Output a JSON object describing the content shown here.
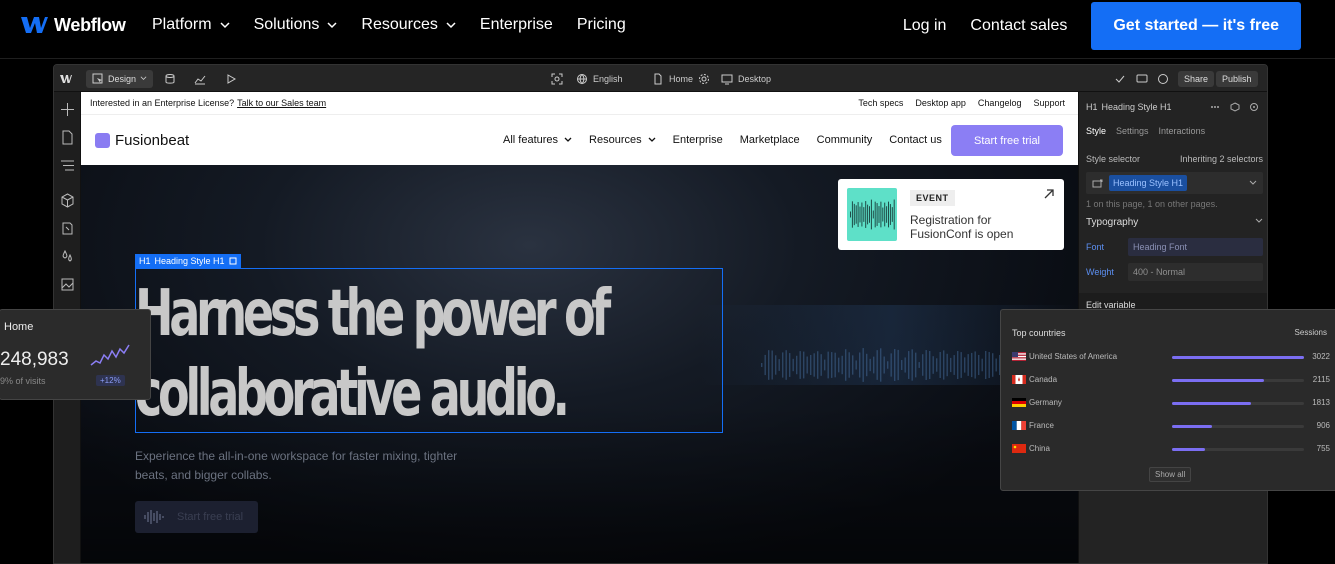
{
  "nav": {
    "brand": "Webflow",
    "links": [
      {
        "label": "Platform",
        "dropdown": true
      },
      {
        "label": "Solutions",
        "dropdown": true
      },
      {
        "label": "Resources",
        "dropdown": true
      },
      {
        "label": "Enterprise",
        "dropdown": false
      },
      {
        "label": "Pricing",
        "dropdown": false
      }
    ],
    "login": "Log in",
    "contact": "Contact sales",
    "cta": "Get started — it's free",
    "cta_color": "#146ef5"
  },
  "designer": {
    "mode": "Design",
    "locale": "English",
    "page": "Home",
    "breakpoint": "Desktop",
    "share": "Share",
    "publish": "Publish",
    "site": {
      "banner_text": "Interested in an Enterprise License?",
      "banner_link": "Talk to our Sales team",
      "banner_links": [
        "Tech specs",
        "Desktop app",
        "Changelog",
        "Support"
      ],
      "brand": "Fusionbeat",
      "links": [
        {
          "label": "All features",
          "dropdown": true
        },
        {
          "label": "Resources",
          "dropdown": true
        },
        {
          "label": "Enterprise",
          "dropdown": false
        },
        {
          "label": "Marketplace",
          "dropdown": false
        },
        {
          "label": "Community",
          "dropdown": false
        },
        {
          "label": "Contact us",
          "dropdown": false
        }
      ],
      "cta": "Start free trial",
      "event_badge": "EVENT",
      "event_text": "Registration for FusionConf is open",
      "selection_tag": "Heading Style H1",
      "hero_title_line1": "Harness the power of",
      "hero_title_line2": "collaborative audio.",
      "hero_sub": "Experience the all-in-one workspace for faster mixing, tighter beats, and bigger collabs.",
      "hero_btn": "Start free trial"
    },
    "panel": {
      "element": "Heading Style H1",
      "tabs": [
        "Style",
        "Settings",
        "Interactions"
      ],
      "style_selector": "Style selector",
      "inheriting": "Inheriting 2 selectors",
      "selector_chip": "Heading Style H1",
      "usage": "1 on this page, 1 on other pages.",
      "typography": "Typography",
      "font_label": "Font",
      "font_value": "Heading Font",
      "weight_label": "Weight",
      "weight_value": "400 - Normal",
      "edit_variable": "Edit variable"
    }
  },
  "home_card": {
    "title": "Home",
    "value": "248,983",
    "sub": "9% of visits",
    "badge": "+12%"
  },
  "countries": {
    "title": "Top countries",
    "metric": "Sessions",
    "max": 3022,
    "rows": [
      {
        "name": "United States of America",
        "value": 3022,
        "flag": "us"
      },
      {
        "name": "Canada",
        "value": 2115,
        "flag": "ca"
      },
      {
        "name": "Germany",
        "value": 1813,
        "flag": "de"
      },
      {
        "name": "France",
        "value": 906,
        "flag": "fr"
      },
      {
        "name": "China",
        "value": 755,
        "flag": "cn"
      }
    ],
    "show_all": "Show all",
    "bar_color": "#7b6ef2"
  }
}
